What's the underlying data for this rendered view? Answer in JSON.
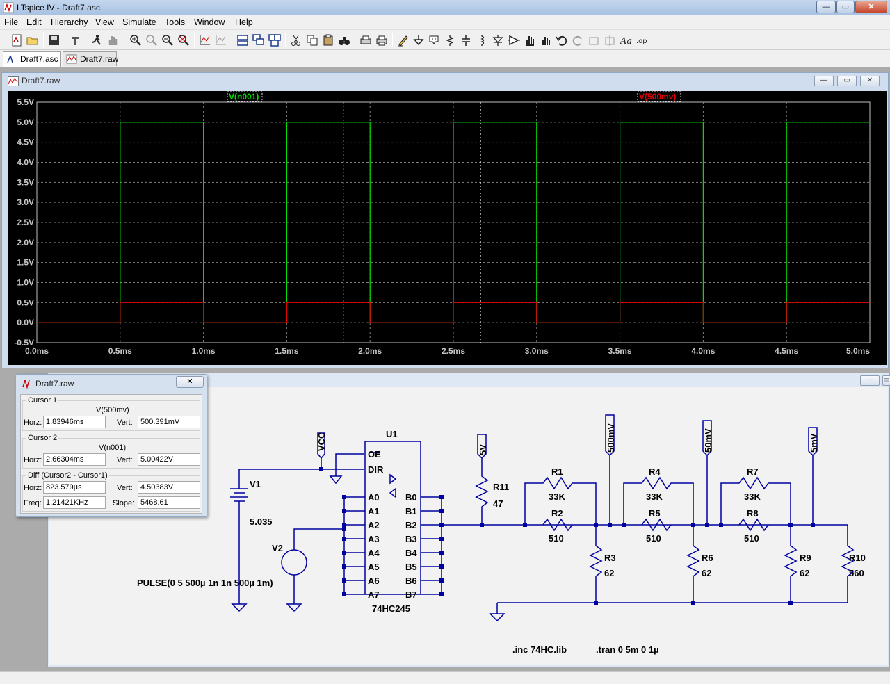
{
  "window": {
    "title": "LTspice IV - Draft7.asc",
    "minimize": "—",
    "maximize": "▭",
    "close": "✕"
  },
  "menu": [
    "File",
    "Edit",
    "Hierarchy",
    "View",
    "Simulate",
    "Tools",
    "Window",
    "Help"
  ],
  "tabs": [
    {
      "label": "Draft7.asc"
    },
    {
      "label": "Draft7.raw"
    }
  ],
  "waveform_window": {
    "title": "Draft7.raw",
    "buttons": {
      "minimize": "—",
      "restore": "▭",
      "close": "✕"
    }
  },
  "chart_data": {
    "type": "line",
    "xlim": [
      0,
      5
    ],
    "ylim": [
      -0.5,
      5.5
    ],
    "x_tick_labels": [
      "0.0ms",
      "0.5ms",
      "1.0ms",
      "1.5ms",
      "2.0ms",
      "2.5ms",
      "3.0ms",
      "3.5ms",
      "4.0ms",
      "4.5ms",
      "5.0ms"
    ],
    "y_tick_labels": [
      "5.5V",
      "5.0V",
      "4.5V",
      "4.0V",
      "3.5V",
      "3.0V",
      "2.5V",
      "2.0V",
      "1.5V",
      "1.0V",
      "0.5V",
      "0.0V",
      "-0.5V"
    ],
    "grid": true,
    "series": [
      {
        "name": "V(n001)",
        "color": "#00e000",
        "low": 0,
        "high": 5,
        "edges": [
          0.5,
          1.0,
          1.5,
          2.0,
          2.5,
          3.0,
          3.5,
          4.0,
          4.5
        ]
      },
      {
        "name": "V(500mv)",
        "color": "#e00000",
        "low": 0,
        "high": 0.5,
        "edges": [
          0.5,
          1.0,
          1.5,
          2.0,
          2.5,
          3.0,
          3.5,
          4.0,
          4.5
        ]
      }
    ],
    "cursors_x": [
      1.83946,
      2.66304
    ]
  },
  "cursor_dialog": {
    "title": "Draft7.raw",
    "close": "✕",
    "cursor1": {
      "title": "Cursor 1",
      "trace": "V(500mv)",
      "horz_label": "Horz:",
      "horz": "1.83946ms",
      "vert_label": "Vert:",
      "vert": "500.391mV"
    },
    "cursor2": {
      "title": "Cursor 2",
      "trace": "V(n001)",
      "horz_label": "Horz:",
      "horz": "2.66304ms",
      "vert_label": "Vert:",
      "vert": "5.00422V"
    },
    "diff": {
      "title": "Diff (Cursor2 - Cursor1)",
      "horz_label": "Horz:",
      "horz": "823.579µs",
      "vert_label": "Vert:",
      "vert": "4.50383V",
      "freq_label": "Freq:",
      "freq": "1.21421KHz",
      "slope_label": "Slope:",
      "slope": "5468.61"
    }
  },
  "schematic": {
    "buttons": {
      "minimize": "—",
      "restore": "▭"
    },
    "labels": {
      "vcc": "VCC",
      "u1": "U1",
      "ic": "74HC245",
      "oe": "OE",
      "dir": "DIR",
      "a_pins": [
        "A0",
        "A1",
        "A2",
        "A3",
        "A4",
        "A5",
        "A6",
        "A7"
      ],
      "b_pins": [
        "B0",
        "B1",
        "B2",
        "B3",
        "B4",
        "B5",
        "B6",
        "B7"
      ],
      "v1": "V1",
      "v1_val": "5.035",
      "v2": "V2",
      "pulse": "PULSE(0 5 500µ 1n 1n 500µ 1m)",
      "flag_5v": "5V",
      "flag_500mv": "500mV",
      "flag_50mv": "50mV",
      "flag_5mv": "5mV",
      "r11": "R11",
      "r11_val": "47",
      "r1": "R1",
      "r1_val": "33K",
      "r2": "R2",
      "r2_val": "510",
      "r3": "R3",
      "r3_val": "62",
      "r4": "R4",
      "r4_val": "33K",
      "r5": "R5",
      "r5_val": "510",
      "r6": "R6",
      "r6_val": "62",
      "r7": "R7",
      "r7_val": "33K",
      "r8": "R8",
      "r8_val": "510",
      "r9": "R9",
      "r9_val": "62",
      "r10": "R10",
      "r10_val": "560",
      "inc": ".inc 74HC.lib",
      "tran": ".tran 0 5m 0 1µ"
    }
  }
}
